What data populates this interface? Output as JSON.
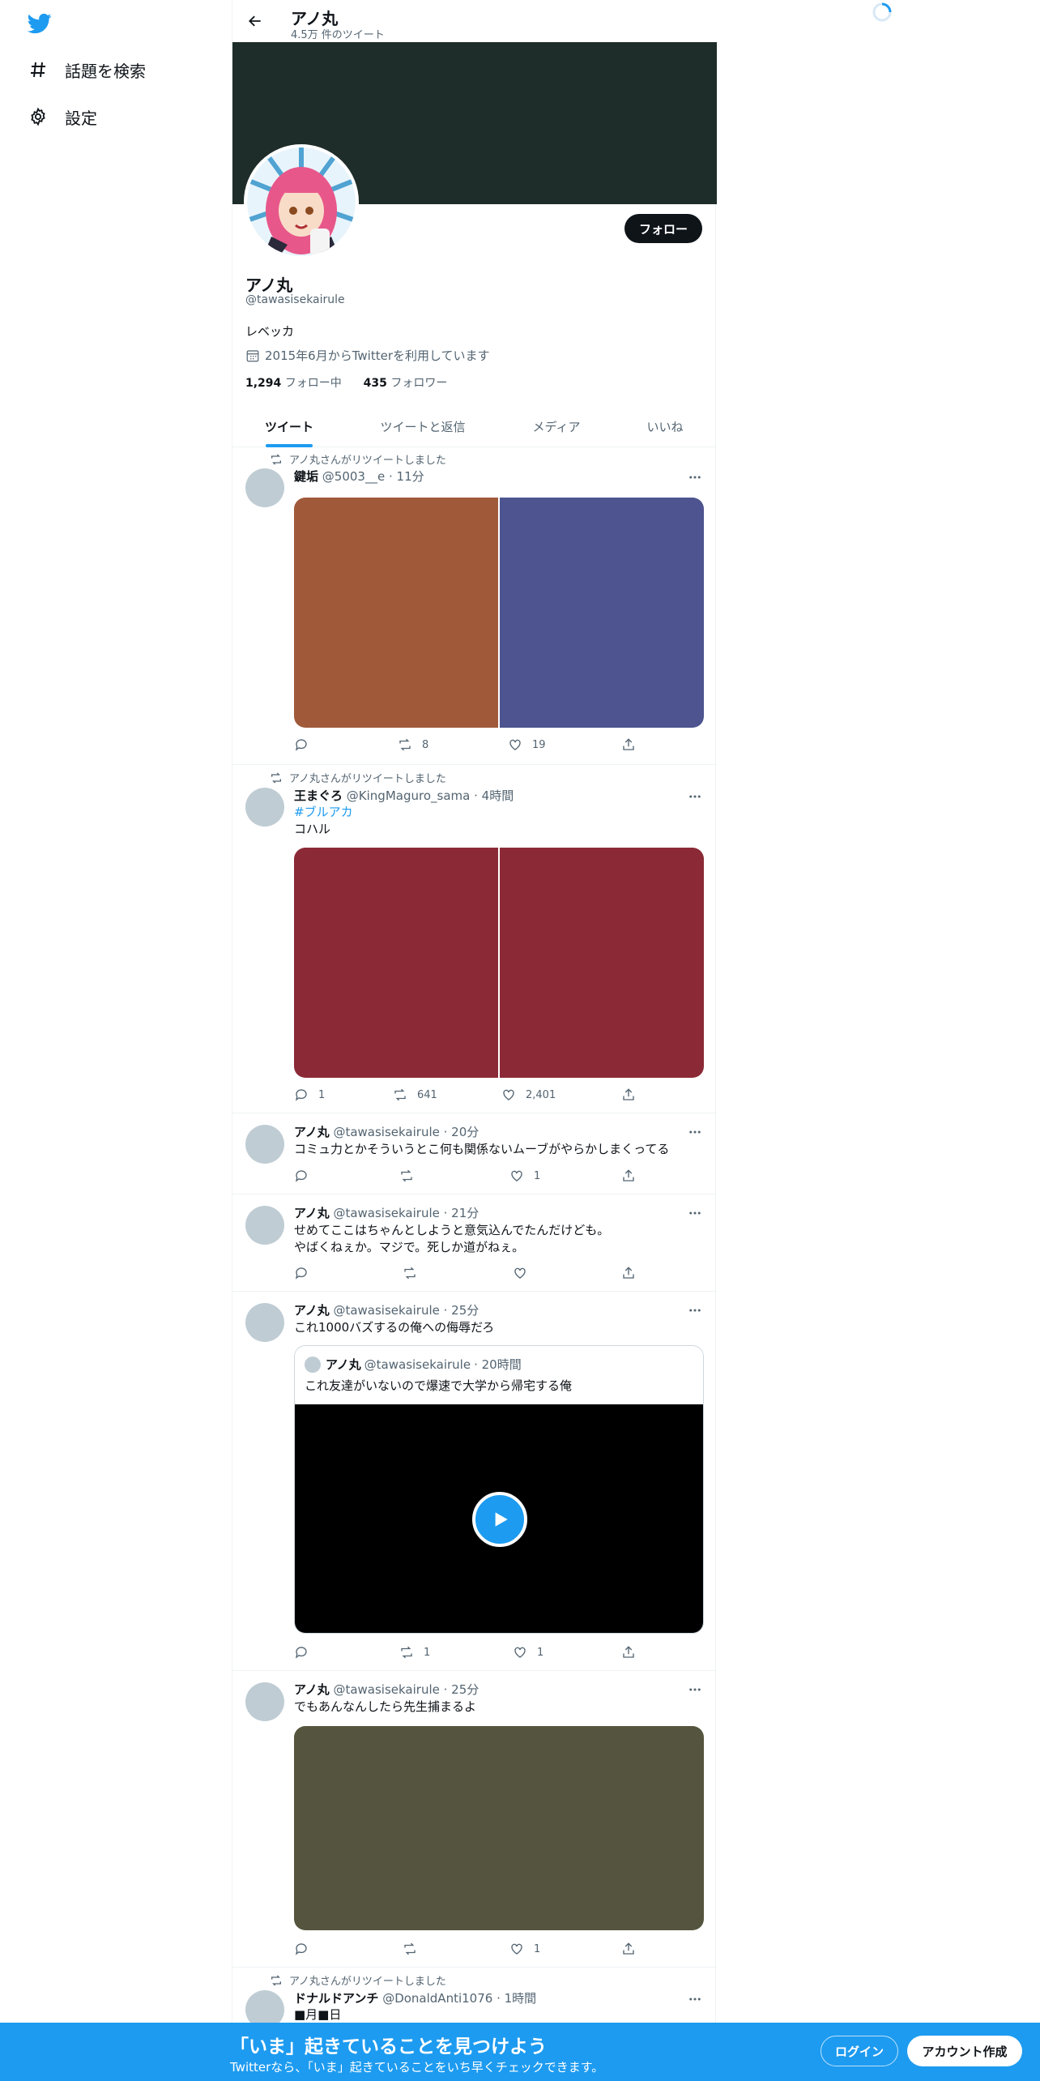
{
  "nav": {
    "explore_label": "話題を検索",
    "settings_label": "設定"
  },
  "header": {
    "title": "アノ丸",
    "subtitle": "4.5万 件のツイート"
  },
  "profile": {
    "follow_label": "フォロー",
    "name": "アノ丸",
    "handle": "@tawasisekairule",
    "bio": "レベッカ",
    "joined": "2015年6月からTwitterを利用しています",
    "following_count": "1,294",
    "following_label": "フォロー中",
    "followers_count": "435",
    "followers_label": "フォロワー"
  },
  "tabs": [
    "ツイート",
    "ツイートと返信",
    "メディア",
    "いいね"
  ],
  "tweets": [
    {
      "retweet_note": "アノ丸さんがリツイートしました",
      "name": "鍵垢",
      "handle": "@5003__e",
      "time": "· 11分",
      "text": "",
      "media_colors": [
        "#a05a3a",
        "#4d5490"
      ],
      "replies": "",
      "retweets": "8",
      "likes": "19"
    },
    {
      "retweet_note": "アノ丸さんがリツイートしました",
      "name": "王まぐろ",
      "handle": "@KingMaguro_sama",
      "time": "· 4時間",
      "hashtag": "#ブルアカ",
      "text": "コハル",
      "media_colors": [
        "#8b2a36",
        "#8b2a36"
      ],
      "replies": "1",
      "retweets": "641",
      "likes": "2,401"
    },
    {
      "name": "アノ丸",
      "handle": "@tawasisekairule",
      "time": "· 20分",
      "text": "コミュ力とかそういうとこ何も関係ないムーブがやらかしまくってる",
      "replies": "",
      "retweets": "",
      "likes": "1"
    },
    {
      "name": "アノ丸",
      "handle": "@tawasisekairule",
      "time": "· 21分",
      "text_line1": "せめてここはちゃんとしようと意気込んでたんだけども。",
      "text_line2": "やばくねぇか。マジで。死しか道がねぇ。",
      "replies": "",
      "retweets": "",
      "likes": ""
    },
    {
      "name": "アノ丸",
      "handle": "@tawasisekairule",
      "time": "· 25分",
      "text": "これ1000バズするの俺への侮辱だろ",
      "quote": {
        "name": "アノ丸",
        "handle": "@tawasisekairule",
        "time": "· 20時間",
        "text": "これ友達がいないので爆速で大学から帰宅する俺"
      },
      "replies": "",
      "retweets": "1",
      "likes": "1"
    },
    {
      "name": "アノ丸",
      "handle": "@tawasisekairule",
      "time": "· 25分",
      "text": "でもあんなんしたら先生捕まるよ",
      "media_colors": [
        "#55553f"
      ],
      "replies": "",
      "retweets": "",
      "likes": "1"
    },
    {
      "retweet_note": "アノ丸さんがリツイートしました",
      "name": "ドナルドアンチ",
      "handle": "@DonaldAnti1076",
      "time": "· 1時間",
      "text": "■月■日"
    }
  ],
  "bottom_bar": {
    "title": "「いま」起きていることを見つけよう",
    "subtitle": "Twitterなら、「いま」起きていることをいち早くチェックできます。",
    "login_label": "ログイン",
    "signup_label": "アカウント作成"
  },
  "colors": {
    "accent": "#1d9bf0",
    "banner": "#1f2d2a"
  }
}
